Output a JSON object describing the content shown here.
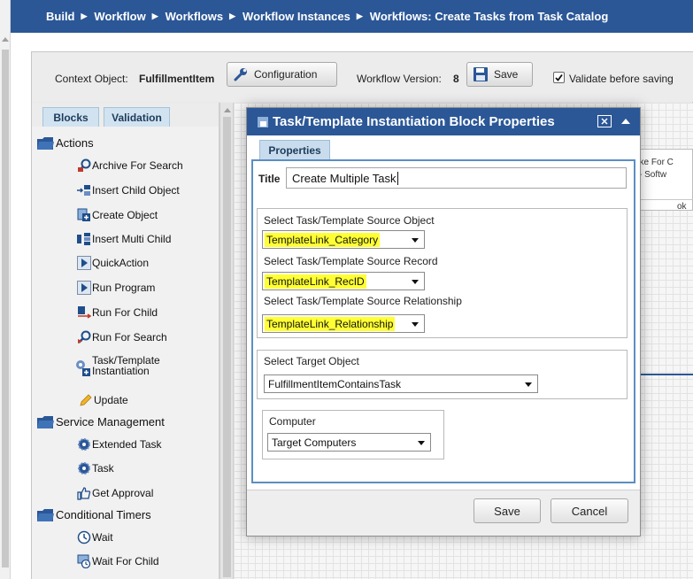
{
  "breadcrumb": [
    {
      "label": "Build"
    },
    {
      "label": "Workflow"
    },
    {
      "label": "Workflows"
    },
    {
      "label": "Workflow Instances"
    },
    {
      "label": "Workflows: Create Tasks from Task Catalog"
    }
  ],
  "toolbar": {
    "context_label": "Context Object:",
    "context_value": "FulfillmentItem",
    "configuration_label": "Configuration",
    "version_label": "Workflow Version:",
    "version_value": "8",
    "save_label": "Save",
    "validate_label": "Validate before saving",
    "validate_checked": true
  },
  "left_panel": {
    "tabs": [
      {
        "label": "Blocks"
      },
      {
        "label": "Validation"
      }
    ],
    "groups": [
      {
        "label": "Actions"
      },
      {
        "label": "Service Management"
      },
      {
        "label": "Conditional Timers"
      }
    ],
    "items": [
      {
        "label": "Archive For Search",
        "icon": "archive-search-icon"
      },
      {
        "label": "Insert Child Object",
        "icon": "insert-child-icon"
      },
      {
        "label": "Create Object",
        "icon": "create-object-icon"
      },
      {
        "label": "Insert Multi Child",
        "icon": "insert-multi-child-icon"
      },
      {
        "label": "QuickAction",
        "icon": "play-icon"
      },
      {
        "label": "Run Program",
        "icon": "play-icon"
      },
      {
        "label": "Run For Child",
        "icon": "run-for-child-icon"
      },
      {
        "label": "Run For Search",
        "icon": "run-search-icon"
      },
      {
        "label": "Task/Template",
        "label2": "Instantiation",
        "icon": "gears-icon"
      },
      {
        "label": "Update",
        "icon": "pencil-icon"
      },
      {
        "label": "Extended Task",
        "icon": "gear-icon"
      },
      {
        "label": "Task",
        "icon": "gear-icon"
      },
      {
        "label": "Get Approval",
        "icon": "thumbs-up-icon"
      },
      {
        "label": "Wait",
        "icon": "clock-icon"
      },
      {
        "label": "Wait For Child",
        "icon": "wait-child-icon"
      }
    ]
  },
  "canvas": {
    "block_lines": [
      "oke For C",
      "- Softw",
      "ok"
    ]
  },
  "dialog": {
    "title": "Task/Template Instantiation Block Properties",
    "tab_label": "Properties",
    "title_field_label": "Title",
    "title_field_value": "Create Multiple Task",
    "source_object_label": "Select Task/Template Source Object",
    "source_object_value": "TemplateLink_Category",
    "source_record_label": "Select Task/Template Source Record",
    "source_record_value": "TemplateLink_RecID",
    "source_relationship_label": "Select Task/Template Source Relationship",
    "source_relationship_value": "TemplateLink_Relationship",
    "target_object_label": "Select Target Object",
    "target_object_value": "FulfillmentItemContainsTask",
    "computer_label": "Computer",
    "computer_value": "Target Computers",
    "save_label": "Save",
    "cancel_label": "Cancel"
  },
  "colors": {
    "header_blue": "#2b5797",
    "highlight_yellow": "#ffff33",
    "tab_blue": "#d1e3f1"
  }
}
